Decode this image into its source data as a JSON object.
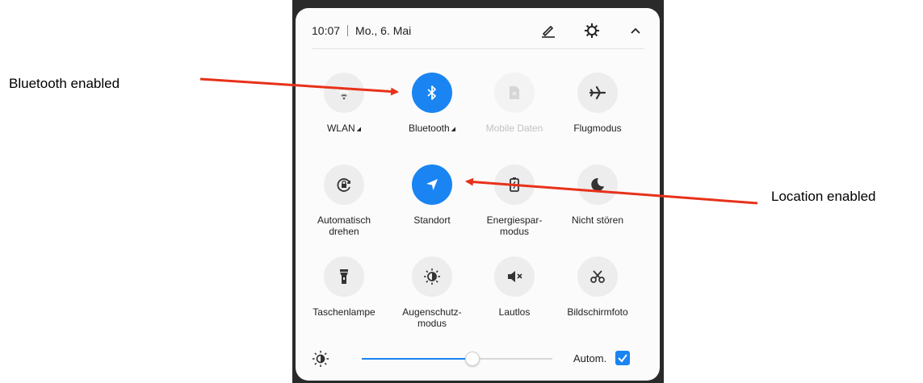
{
  "annotations": {
    "left": "Bluetooth enabled",
    "right": "Location enabled"
  },
  "header": {
    "time": "10:07",
    "date": "Mo., 6. Mai",
    "icons": [
      "edit-icon",
      "settings-gear-icon",
      "collapse-chevron-up-icon"
    ]
  },
  "tiles": [
    {
      "label": "WLAN",
      "icon": "wifi-icon",
      "state": "off",
      "caret": true
    },
    {
      "label": "Bluetooth",
      "icon": "bluetooth-icon",
      "state": "on",
      "caret": true
    },
    {
      "label": "Mobile Daten",
      "icon": "sim-card-icon",
      "state": "disabled"
    },
    {
      "label": "Flugmodus",
      "icon": "airplane-icon",
      "state": "off"
    },
    {
      "label": "Automatisch drehen",
      "icon": "rotation-lock-icon",
      "state": "off"
    },
    {
      "label": "Standort",
      "icon": "location-arrow-icon",
      "state": "on"
    },
    {
      "label": "Energiespar-modus",
      "icon": "battery-saver-icon",
      "state": "off"
    },
    {
      "label": "Nicht stören",
      "icon": "moon-icon",
      "state": "off"
    },
    {
      "label": "Taschenlampe",
      "icon": "flashlight-icon",
      "state": "off"
    },
    {
      "label": "Augenschutz-modus",
      "icon": "eye-comfort-icon",
      "state": "off"
    },
    {
      "label": "Lautlos",
      "icon": "mute-icon",
      "state": "off"
    },
    {
      "label": "Bildschirmfoto",
      "icon": "scissors-icon",
      "state": "off"
    }
  ],
  "brightness": {
    "icon": "brightness-icon",
    "level": 0.58,
    "auto_label": "Autom.",
    "auto_checked": true
  },
  "colors": {
    "accent": "#1a84f2",
    "arrow": "#e8311a"
  }
}
